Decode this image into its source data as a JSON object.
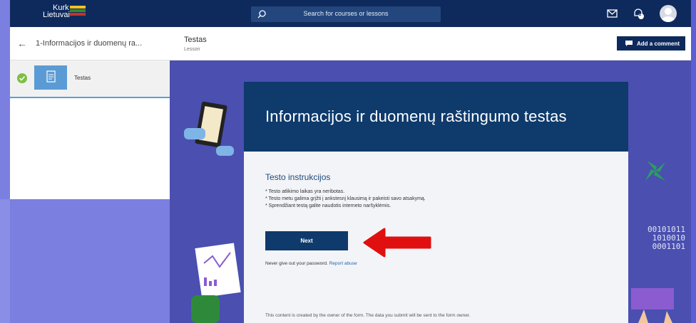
{
  "topbar": {
    "logo_line1": "Kurk",
    "logo_line2": "Lietuvai",
    "search_placeholder": "Search for courses or lessons",
    "notification_count": "2"
  },
  "sidebar": {
    "course_title": "1-Informacijos ir duomenų ra...",
    "lessons": [
      {
        "label": "Testas",
        "status": "completed"
      }
    ]
  },
  "content_header": {
    "title": "Testas",
    "subtitle": "Lesson",
    "add_comment_label": "Add a comment"
  },
  "form": {
    "title": "Informacijos ir duomenų raštingumo testas",
    "instructions_title": "Testo instrukcijos",
    "instructions": [
      "* Testo atlikimo laikas yra neribotas.",
      "* Testo metu galima grįžti į ankstesnį klausimą ir pakeisti savo atsakymą.",
      "* Sprendžiant testą galite naudotis interneto naršyklėmis."
    ],
    "next_label": "Next",
    "password_note": "Never give out your password.",
    "report_abuse": "Report abuse",
    "footer_note": "This content is created by the owner of the form. The data you submit will be sent to the form owner."
  },
  "decor": {
    "binary_lines": [
      "00101011",
      "1010010",
      "0001101"
    ]
  },
  "colors": {
    "topbar": "#0e2a5c",
    "card_header": "#0e3a6c",
    "form_background": "#4a4fb0",
    "frame": "#7b7fe0",
    "check": "#7cbf43",
    "arrow": "#e01010"
  }
}
